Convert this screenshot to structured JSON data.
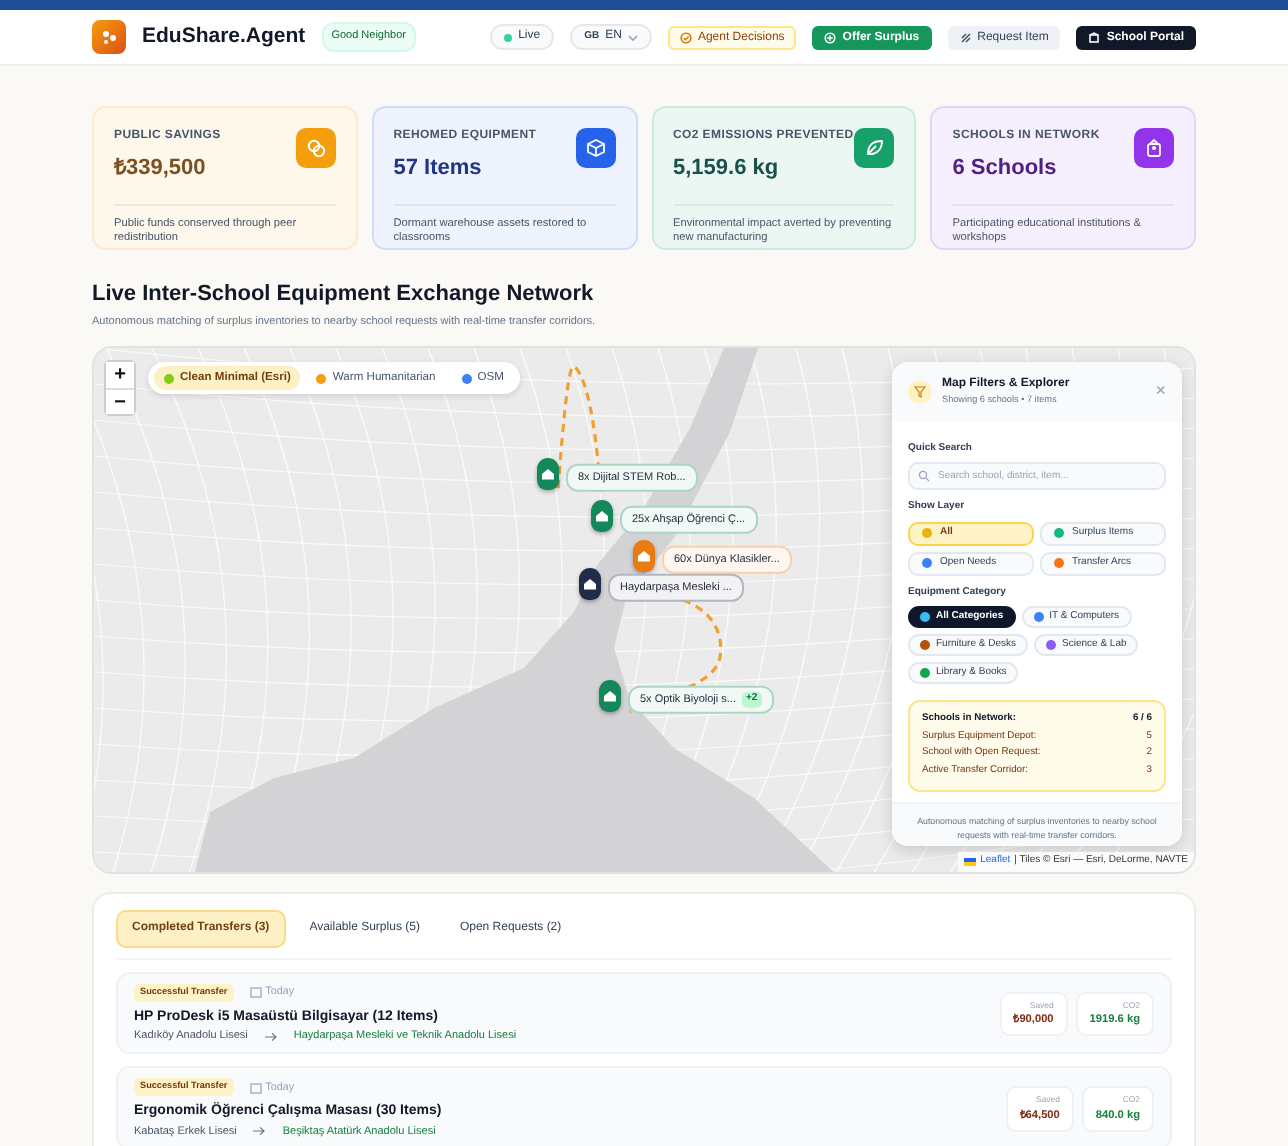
{
  "header": {
    "brand": "EduShare.Agent",
    "badge": "Good Neighbor",
    "live": "Live",
    "language": {
      "flag": "GB",
      "code": "EN"
    },
    "actions": [
      {
        "label": "Agent Decisions",
        "kind": "outline"
      },
      {
        "label": "Offer Surplus",
        "kind": "success"
      },
      {
        "label": "Request Item",
        "kind": "light"
      },
      {
        "label": "School Portal",
        "kind": "dark"
      }
    ]
  },
  "stats": [
    {
      "label": "PUBLIC SAVINGS",
      "value": "₺339,500",
      "note": "Public funds conserved through peer redistribution",
      "color": "#f59e0b"
    },
    {
      "label": "REHOMED EQUIPMENT",
      "value": "57 Items",
      "note": "Dormant warehouse assets restored to classrooms",
      "color": "#2563eb"
    },
    {
      "label": "CO2 EMISSIONS PREVENTED",
      "value": "5,159.6 kg",
      "note": "Environmental impact averted by preventing new manufacturing",
      "color": "#16a06a"
    },
    {
      "label": "SCHOOLS IN NETWORK",
      "value": "6 Schools",
      "note": "Participating educational institutions & workshops",
      "color": "#9333ea"
    }
  ],
  "network": {
    "title": "Live Inter-School Equipment Exchange Network",
    "subtitle": "Autonomous matching of surplus inventories to nearby school requests with real-time transfer corridors.",
    "map": {
      "zoom_in": "+",
      "zoom_out": "−",
      "styles": [
        {
          "label": "Clean Minimal (Esri)",
          "selected": true,
          "color": "#84cc16"
        },
        {
          "label": "Warm Humanitarian",
          "selected": false,
          "color": "#f59e0b"
        },
        {
          "label": "OSM",
          "selected": false,
          "color": "#3b82f6"
        }
      ],
      "markers": [
        {
          "label": "8x Dijital STEM Rob...",
          "color": "#15885a"
        },
        {
          "label": "25x Ahşap Öğrenci Ç...",
          "color": "#15885a"
        },
        {
          "label": "60x Dünya Klasikler...",
          "color": "#ea7b10"
        },
        {
          "label": "Haydarpaşa Mesleki ...",
          "color": "#1f2d4a"
        },
        {
          "label": "5x Optik Biyoloji s...",
          "color": "#15885a",
          "extra": "+2"
        }
      ],
      "attribution": {
        "link": "Leaflet",
        "text": "| Tiles © Esri — Esri, DeLorme, NAVTE"
      },
      "panel": {
        "title": "Map Filters & Explorer",
        "subtitle": "Showing 6 schools • 7 items",
        "close": "×",
        "search_label": "Quick Search",
        "search": {
          "placeholder": "Search school, district, item..."
        },
        "layer_label": "Show Layer",
        "layers": [
          {
            "label": "All",
            "selected": true,
            "color": "#eab308"
          },
          {
            "label": "Surplus Items",
            "selected": false,
            "color": "#10b981"
          },
          {
            "label": "Open Needs",
            "selected": false,
            "color": "#3b82f6"
          },
          {
            "label": "Transfer Arcs",
            "selected": false,
            "color": "#f97316"
          }
        ],
        "category_label": "Equipment Category",
        "categories": [
          {
            "label": "All Categories",
            "selected": true,
            "color": "#38bdf8"
          },
          {
            "label": "IT & Computers",
            "selected": false,
            "color": "#3b82f6"
          },
          {
            "label": "Furniture & Desks",
            "selected": false,
            "color": "#b45309"
          },
          {
            "label": "Science & Lab",
            "selected": false,
            "color": "#8b5cf6"
          },
          {
            "label": "Library & Books",
            "selected": false,
            "color": "#16a34a"
          }
        ],
        "summary": [
          {
            "label": "Schools in Network:",
            "value": "6 / 6",
            "kind": "head"
          },
          {
            "label": "Surplus Equipment Depot:",
            "value": "5",
            "kind": "item"
          },
          {
            "label": "School with Open Request:",
            "value": "2",
            "kind": "item"
          },
          {
            "label": "Active Transfer Corridor:",
            "value": "3",
            "kind": "item"
          }
        ],
        "footer": "Autonomous matching of surplus inventories to nearby school requests with real-time transfer corridors."
      }
    }
  },
  "activity": {
    "tabs": [
      {
        "label": "Completed Transfers (3)",
        "selected": true
      },
      {
        "label": "Available Surplus (5)",
        "selected": false
      },
      {
        "label": "Open Requests (2)",
        "selected": false
      }
    ],
    "transfers": [
      {
        "badge": "Successful Transfer",
        "date": "Today",
        "title": "HP ProDesk i5 Masaüstü Bilgisayar (12 Items)",
        "from": "Kadıköy Anadolu Lisesi",
        "to": "Haydarpaşa Mesleki ve Teknik Anadolu Lisesi",
        "saved_label": "Saved",
        "saved": "₺90,000",
        "co2_label": "CO2",
        "co2": "1919.6 kg"
      },
      {
        "badge": "Successful Transfer",
        "date": "Today",
        "title": "Ergonomik Öğrenci Çalışma Masası (30 Items)",
        "from": "Kabataş Erkek Lisesi",
        "to": "Beşiktaş Atatürk Anadolu Lisesi",
        "saved_label": "Saved",
        "saved": "₺64,500",
        "co2_label": "CO2",
        "co2": "840.0 kg"
      }
    ]
  }
}
